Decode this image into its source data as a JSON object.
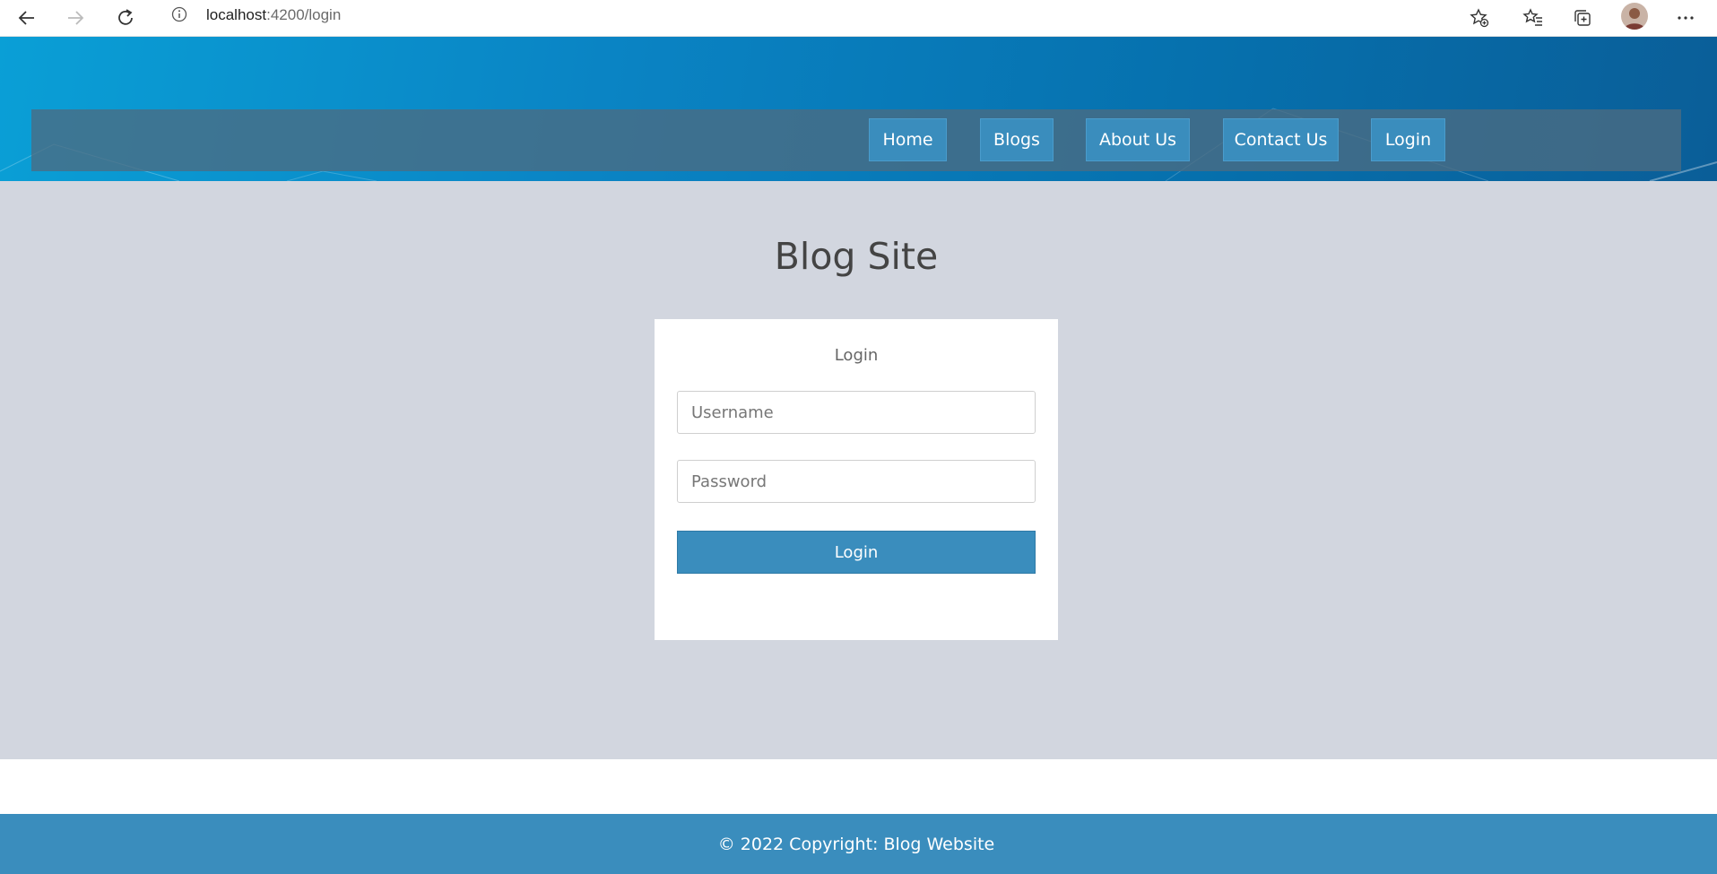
{
  "browser": {
    "url_host": "localhost",
    "url_path": ":4200/login",
    "icons": [
      "back-arrow-icon",
      "forward-arrow-icon",
      "refresh-icon",
      "info-icon",
      "favorite-star-add-icon",
      "favorites-list-icon",
      "collections-icon",
      "avatar",
      "more-menu-icon"
    ]
  },
  "navbar": {
    "items": [
      {
        "label": "Home"
      },
      {
        "label": "Blogs"
      },
      {
        "label": "About Us"
      },
      {
        "label": "Contact Us"
      },
      {
        "label": "Login"
      }
    ]
  },
  "main": {
    "title": "Blog Site",
    "login_card": {
      "title": "Login",
      "username_placeholder": "Username",
      "password_placeholder": "Password",
      "submit_label": "Login"
    }
  },
  "footer": {
    "text": "© 2022 Copyright: Blog Website"
  },
  "colors": {
    "accent": "#3a8dbd",
    "page_background": "#d2d6df",
    "banner_start": "#0a9fd6",
    "banner_end": "#0a5e98"
  }
}
